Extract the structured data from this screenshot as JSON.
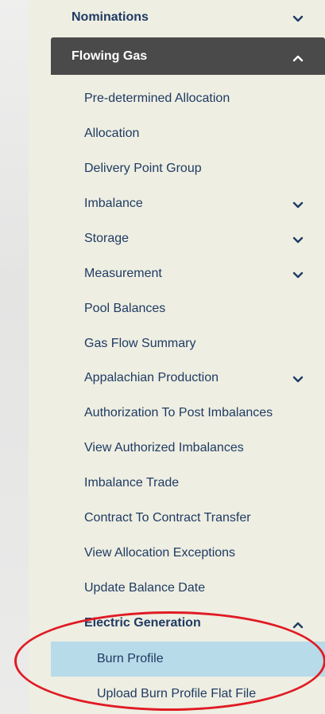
{
  "menu": {
    "nominations": {
      "label": "Nominations",
      "icon": "chevron-down-icon"
    },
    "flowing_gas": {
      "label": "Flowing Gas",
      "icon": "chevron-up-icon"
    },
    "items": [
      {
        "label": "Pre-determined Allocation",
        "has_submenu": false
      },
      {
        "label": "Allocation",
        "has_submenu": false
      },
      {
        "label": "Delivery Point Group",
        "has_submenu": false
      },
      {
        "label": "Imbalance",
        "has_submenu": true
      },
      {
        "label": "Storage",
        "has_submenu": true
      },
      {
        "label": "Measurement",
        "has_submenu": true
      },
      {
        "label": "Pool Balances",
        "has_submenu": false
      },
      {
        "label": "Gas Flow Summary",
        "has_submenu": false
      },
      {
        "label": "Appalachian Production",
        "has_submenu": true
      },
      {
        "label": "Authorization To Post Imbalances",
        "has_submenu": false
      },
      {
        "label": "View Authorized Imbalances",
        "has_submenu": false
      },
      {
        "label": "Imbalance Trade",
        "has_submenu": false
      },
      {
        "label": "Contract To Contract Transfer",
        "has_submenu": false
      },
      {
        "label": "View Allocation Exceptions",
        "has_submenu": false
      },
      {
        "label": "Update Balance Date",
        "has_submenu": false
      }
    ],
    "electric_generation": {
      "label": "Electric Generation",
      "icon": "chevron-up-icon",
      "items": [
        {
          "label": "Burn Profile",
          "selected": true
        },
        {
          "label": "Upload Burn Profile Flat File",
          "selected": false
        }
      ]
    }
  },
  "colors": {
    "panel_bg": "#eeeee2",
    "active_header_bg": "#4a4a4a",
    "text": "#1f3b63",
    "selected_bg": "#b7dbe9",
    "annotation": "#e01b24"
  }
}
